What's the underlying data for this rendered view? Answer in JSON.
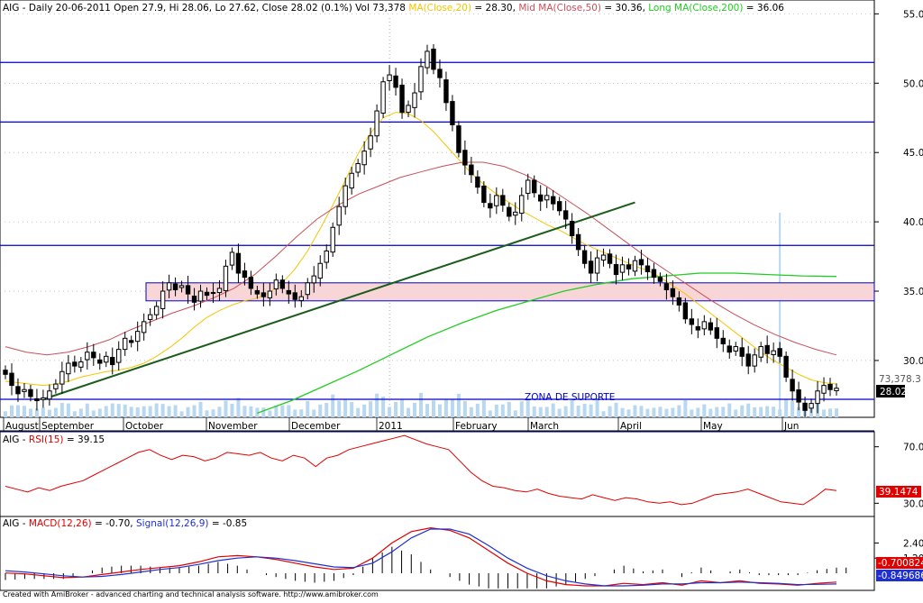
{
  "header": {
    "symbol": "AIG",
    "info": "- Daily 20-06-2011 Open 27.9, Hi 28.06, Lo 27.62, Close 28.02 (0.1%) Vol 73,378",
    "ma20_label": "MA(Close,20)",
    "ma20_value": "= 28.30,",
    "ma50_label": "Mid MA(Close,50)",
    "ma50_value": "= 30.36,",
    "ma200_label": "Long MA(Close,200)",
    "ma200_value": "= 36.06"
  },
  "annotation": "ZONA DE SUPORTE",
  "footer": "Created with AmiBroker - advanced charting and technical analysis software. http://www.amibroker.com",
  "price_badge": "28.02",
  "volume_badge": "73,378.3",
  "rsi_header": {
    "symbol": "AIG",
    "label": "RSI(15)",
    "value": "= 39.15"
  },
  "rsi_badge": "39.1474",
  "macd_header": {
    "symbol": "AIG",
    "label": "MACD(12,26)",
    "value": "= -0.70,",
    "signal_label": "Signal(12,26,9)",
    "signal_value": "= -0.85"
  },
  "macd_badge": "-0.700824",
  "signal_badge": "-0.849686",
  "colors": {
    "candle": "#000000",
    "ma20": "#f5c400",
    "ma50": "#c8505a",
    "ma200": "#22cc22",
    "levels": "#0000cc",
    "trendline": "#1a5c1a",
    "zone": "#f8d6d8",
    "volume": "#b8d8f2",
    "rsi": "#e00000",
    "macd": "#e00000",
    "signal": "#2030d0"
  },
  "chart_data": [
    {
      "type": "candlestick",
      "x_months": [
        "August",
        "September",
        "October",
        "November",
        "December",
        "2011",
        "February",
        "March",
        "April",
        "May",
        "Jun"
      ],
      "y_ticks": [
        30,
        35,
        40,
        45,
        50,
        55
      ],
      "ylim": [
        25.9,
        56
      ],
      "horizontal_levels": [
        51.5,
        47.2,
        38.3,
        27.2,
        24.9
      ],
      "support_zone": [
        34.3,
        35.6
      ],
      "trendline": [
        {
          "day": 6,
          "price": 27.2
        },
        {
          "day": 100,
          "price": 41.4
        }
      ],
      "close": [
        29.0,
        28.2,
        27.6,
        27.9,
        27.4,
        27.1,
        27.3,
        27.8,
        28.3,
        29.2,
        29.8,
        29.6,
        29.9,
        30.6,
        30.2,
        29.8,
        30.3,
        29.7,
        30.8,
        31.6,
        31.3,
        32.1,
        32.8,
        33.3,
        33.9,
        35.0,
        35.6,
        35.1,
        35.4,
        34.8,
        34.2,
        35.0,
        34.7,
        34.9,
        35.2,
        36.8,
        37.8,
        36.3,
        36.0,
        35.2,
        34.8,
        34.6,
        35.0,
        35.8,
        35.2,
        34.8,
        34.4,
        34.6,
        35.6,
        36.1,
        37.0,
        37.9,
        39.6,
        41.1,
        42.6,
        43.5,
        44.2,
        45.1,
        46.2,
        48.0,
        50.1,
        50.6,
        49.7,
        47.9,
        48.4,
        49.3,
        51.2,
        52.3,
        51.0,
        50.4,
        48.6,
        47.0,
        45.0,
        44.1,
        43.4,
        42.5,
        41.4,
        41.0,
        41.9,
        41.2,
        40.4,
        40.7,
        41.9,
        43.0,
        42.1,
        41.5,
        41.9,
        41.3,
        40.8,
        40.2,
        39.0,
        38.0,
        37.0,
        36.3,
        37.4,
        37.6,
        37.0,
        36.2,
        36.9,
        36.6,
        37.2,
        36.9,
        36.4,
        36.0,
        35.7,
        35.1,
        34.6,
        34.0,
        33.0,
        32.6,
        32.2,
        32.8,
        32.2,
        31.6,
        31.2,
        30.6,
        31.0,
        30.3,
        29.6,
        30.4,
        31.0,
        30.5,
        30.7,
        30.3,
        28.8,
        27.8,
        27.0,
        26.4,
        26.9,
        27.8,
        28.2,
        27.9,
        28.0
      ],
      "ma20": [
        28.5,
        28.4,
        28.3,
        28.2,
        28.3,
        28.5,
        28.8,
        29.0,
        29.2,
        29.3,
        29.5,
        29.8,
        30.3,
        30.9,
        31.6,
        32.4,
        33.1,
        33.6,
        34.0,
        34.3,
        34.5,
        34.9,
        35.6,
        36.6,
        37.9,
        39.5,
        41.2,
        43.0,
        44.9,
        46.4,
        47.5,
        47.9,
        47.8,
        47.3,
        46.5,
        45.5,
        44.5,
        43.5,
        42.7,
        42.0,
        41.4,
        40.8,
        40.3,
        39.8,
        39.4,
        38.9,
        38.4,
        38.0,
        37.6,
        37.2,
        36.8,
        36.5,
        36.0,
        35.4,
        34.8,
        34.1,
        33.4,
        32.7,
        32.0,
        31.3,
        30.6,
        30.0,
        29.5,
        29.0,
        28.6,
        28.4,
        28.3
      ],
      "ma50": [
        31.0,
        30.6,
        30.4,
        30.6,
        31.0,
        31.5,
        32.2,
        32.8,
        33.4,
        33.9,
        34.5,
        35.2,
        36.2,
        37.5,
        38.9,
        40.2,
        41.2,
        42.0,
        42.6,
        43.2,
        43.6,
        44.0,
        44.3,
        44.3,
        44.0,
        43.4,
        42.6,
        41.6,
        40.6,
        39.5,
        38.4,
        37.3,
        36.3,
        35.3,
        34.3,
        33.4,
        32.6,
        31.9,
        31.3,
        30.8,
        30.4
      ],
      "ma200": [
        26.2,
        27.1,
        28.2,
        29.3,
        30.5,
        31.7,
        32.7,
        33.6,
        34.3,
        35.0,
        35.5,
        35.9,
        36.1,
        36.3,
        36.3,
        36.2,
        36.1,
        36.06
      ]
    },
    {
      "type": "line",
      "title": "RSI(15)",
      "y_ticks": [
        30.0,
        70.0
      ],
      "series": [
        {
          "name": "RSI(15)",
          "values": [
            42,
            40,
            38,
            41,
            39,
            42,
            44,
            46,
            50,
            54,
            58,
            62,
            66,
            68,
            64,
            61,
            64,
            63,
            60,
            62,
            66,
            65,
            64,
            66,
            62,
            60,
            64,
            62,
            56,
            62,
            64,
            68,
            70,
            72,
            74,
            76,
            78,
            75,
            72,
            70,
            68,
            60,
            52,
            46,
            42,
            41,
            39,
            38,
            40,
            37,
            35,
            34,
            33,
            36,
            34,
            32,
            34,
            33,
            31,
            30,
            31,
            29,
            30,
            33,
            36,
            37,
            38,
            40,
            37,
            34,
            31,
            30,
            29,
            34,
            40,
            39
          ]
        }
      ]
    },
    {
      "type": "line",
      "title": "MACD(12,26)",
      "y_ticks": [
        2.4,
        1.2
      ],
      "series": [
        {
          "name": "MACD(12,26)",
          "values": [
            0.02,
            -0.05,
            -0.2,
            -0.35,
            -0.3,
            -0.1,
            0.1,
            0.3,
            0.45,
            0.6,
            0.9,
            1.3,
            1.4,
            1.3,
            1.1,
            0.8,
            0.5,
            0.3,
            0.4,
            1.2,
            2.4,
            3.3,
            3.6,
            3.4,
            2.8,
            1.8,
            0.8,
            0.0,
            -0.6,
            -0.9,
            -1.0,
            -1.0,
            -0.8,
            -0.9,
            -0.75,
            -0.95,
            -0.6,
            -0.75,
            -0.6,
            -0.8,
            -0.85,
            -0.95,
            -0.8,
            -0.7
          ]
        },
        {
          "name": "Signal(12,26,9)",
          "values": [
            0.2,
            0.1,
            -0.05,
            -0.2,
            -0.3,
            -0.25,
            -0.1,
            0.1,
            0.3,
            0.45,
            0.7,
            1.0,
            1.2,
            1.3,
            1.2,
            1.0,
            0.75,
            0.5,
            0.45,
            0.8,
            1.7,
            2.8,
            3.5,
            3.5,
            3.1,
            2.2,
            1.2,
            0.4,
            -0.2,
            -0.6,
            -0.85,
            -1.0,
            -1.0,
            -0.95,
            -0.85,
            -0.85,
            -0.75,
            -0.75,
            -0.7,
            -0.75,
            -0.8,
            -0.9,
            -0.88,
            -0.85
          ]
        }
      ]
    }
  ]
}
